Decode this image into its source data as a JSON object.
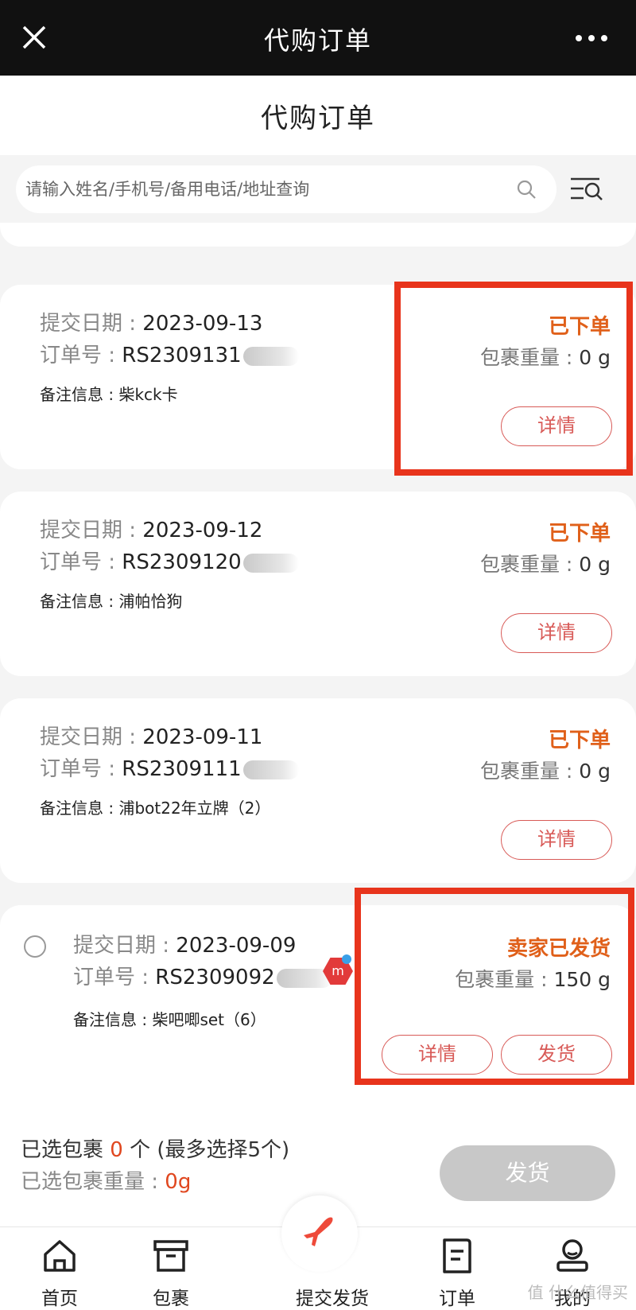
{
  "topbar": {
    "title": "代购订单"
  },
  "page": {
    "title": "代购订单"
  },
  "search": {
    "placeholder": "请输入姓名/手机号/备用电话/地址查询"
  },
  "labels": {
    "date": "提交日期 : ",
    "order": "订单号 : ",
    "note": "备注信息 : ",
    "weight": "包裹重量 : ",
    "detail": "详情",
    "ship": "发货"
  },
  "orders": [
    {
      "date": "2023-09-13",
      "order_no": "RS2309131",
      "note": "柴kck卡",
      "status": "已下单",
      "weight": "0 g"
    },
    {
      "date": "2023-09-12",
      "order_no": "RS2309120",
      "note": "浦帕恰狗",
      "status": "已下单",
      "weight": "0 g"
    },
    {
      "date": "2023-09-11",
      "order_no": "RS2309111",
      "note": "浦bot22年立牌（2）",
      "status": "已下单",
      "weight": "0 g"
    },
    {
      "date": "2023-09-09",
      "order_no": "RS2309092",
      "note": "柴吧唧set（6）",
      "status": "卖家已发货",
      "weight": "150 g",
      "tag": "m"
    }
  ],
  "footer": {
    "selected_prefix": "已选包裹 ",
    "selected_count": "0",
    "selected_suffix": " 个 (最多选择5个)",
    "weight_label": "已选包裹重量 : ",
    "weight_value": "0g",
    "ship_button": "发货"
  },
  "tabs": [
    {
      "label": "首页",
      "icon": "home-icon"
    },
    {
      "label": "包裹",
      "icon": "box-icon"
    },
    {
      "label": "提交发货",
      "icon": "plane-icon"
    },
    {
      "label": "订单",
      "icon": "document-icon"
    },
    {
      "label": "我的",
      "icon": "user-icon"
    }
  ],
  "watermark": "值 什么值得买",
  "colors": {
    "status": "#e0601a",
    "button": "#d85a57",
    "highlight": "#e8341c",
    "topbar": "#111111"
  }
}
